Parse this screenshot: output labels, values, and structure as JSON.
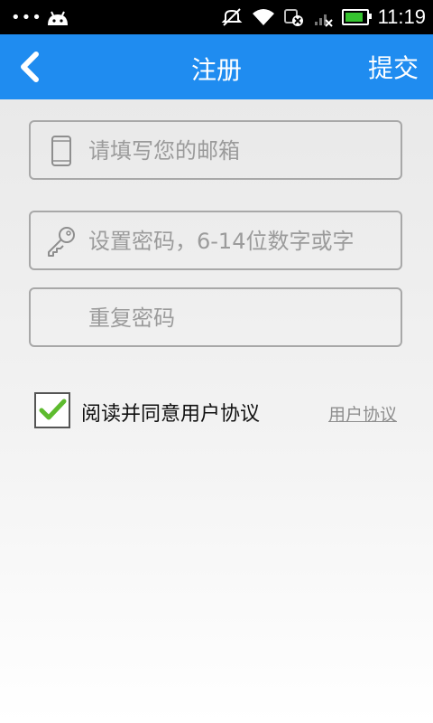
{
  "status_bar": {
    "time": "11:19",
    "icons": [
      "more-dots-icon",
      "android-icon",
      "mute-icon",
      "wifi-icon",
      "data-icon",
      "signal-icon",
      "battery-icon"
    ],
    "battery_color": "#35c32f",
    "battery_level": 0.9
  },
  "header": {
    "title": "注册",
    "submit_label": "提交",
    "back_icon": "chevron-left-icon",
    "background": "#1f8cf0"
  },
  "form": {
    "email": {
      "placeholder": "请填写您的邮箱",
      "value": "",
      "icon": "phone-icon"
    },
    "password": {
      "placeholder": "设置密码，6-14位数字或字",
      "value": "",
      "icon": "key-icon"
    },
    "confirm_password": {
      "placeholder": "重复密码",
      "value": ""
    },
    "agree": {
      "label": "阅读并同意用户协议",
      "checked": true,
      "check_color": "#5dbb2e"
    },
    "protocol_link": "用户协议"
  }
}
